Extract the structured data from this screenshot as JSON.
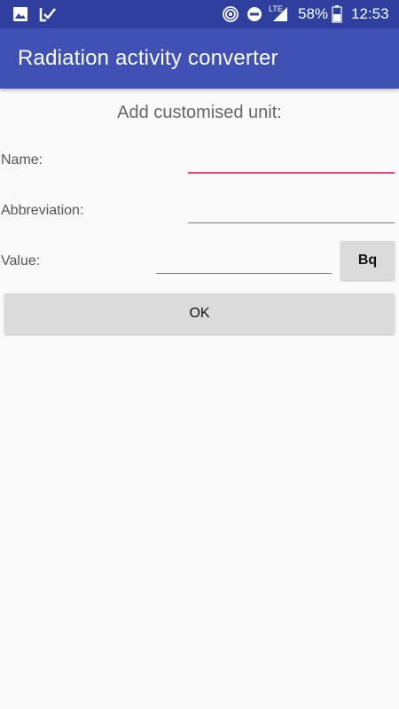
{
  "status_bar": {
    "battery": "58%",
    "time": "12:53",
    "network": "LTE",
    "icons": [
      "image-icon",
      "check-icon",
      "hotspot-icon",
      "dnd-icon",
      "signal-icon",
      "battery-icon"
    ]
  },
  "app_bar": {
    "title": "Radiation activity converter",
    "color": "#3f51b5"
  },
  "form": {
    "heading": "Add customised unit:",
    "name_label": "Name:",
    "name_value": "",
    "abbreviation_label": "Abbreviation:",
    "abbreviation_value": "",
    "value_label": "Value:",
    "value_value": "",
    "unit_button": "Bq",
    "ok_button": "OK",
    "focus_color": "#e0457b"
  }
}
